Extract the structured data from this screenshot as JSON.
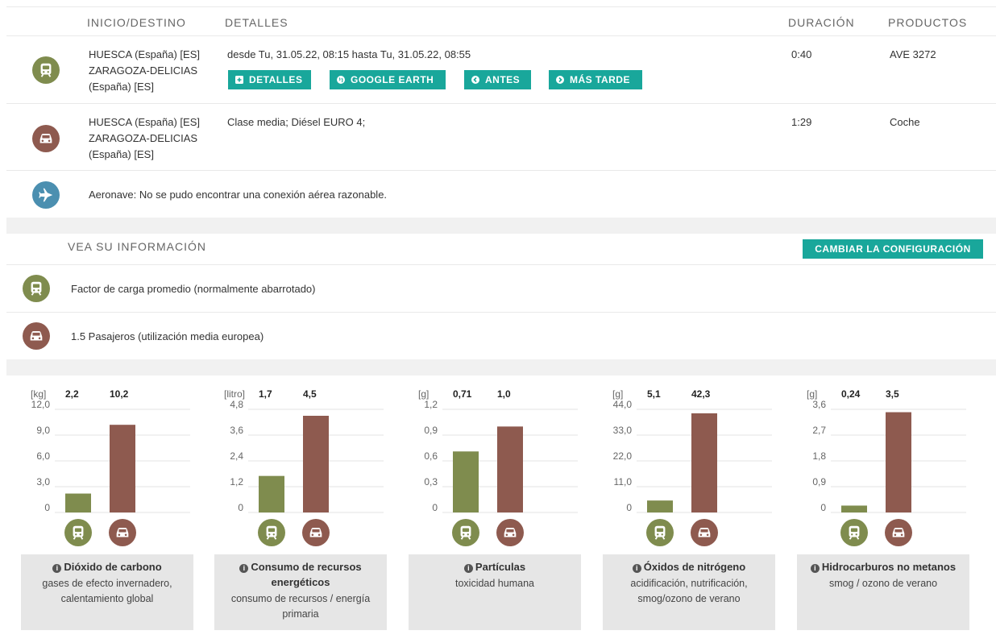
{
  "table": {
    "headers": {
      "origin": "INICIO/DESTINO",
      "details": "DETALLES",
      "duration": "DURACIÓN",
      "products": "PRODUCTOS"
    },
    "rows": [
      {
        "icon": "train-icon",
        "origin_line1": "HUESCA (España) [ES]",
        "origin_line2": "ZARAGOZA-DELICIAS",
        "origin_line3": "(España) [ES]",
        "details": "desde Tu, 31.05.22, 08:15 hasta Tu, 31.05.22, 08:55",
        "duration": "0:40",
        "product": "AVE 3272",
        "buttons": {
          "detalles": "DETALLES",
          "google_earth": "GOOGLE EARTH",
          "antes": "ANTES",
          "mas_tarde": "MÁS TARDE"
        }
      },
      {
        "icon": "car-icon",
        "origin_line1": "HUESCA (España) [ES]",
        "origin_line2": "ZARAGOZA-DELICIAS",
        "origin_line3": "(España) [ES]",
        "details": "Clase media; Diésel EURO 4;",
        "duration": "1:29",
        "product": "Coche"
      },
      {
        "icon": "plane-icon",
        "message": "Aeronave: No se pudo encontrar una conexión aérea razonable."
      }
    ]
  },
  "info": {
    "title": "VEA SU INFORMACIÓN",
    "button": "CAMBIAR LA CONFIGURACIÓN",
    "train_text": "Factor de carga promedio (normalmente abarrotado)",
    "car_text": "1.5 Pasajeros (utilización media europea)"
  },
  "colors": {
    "train": "#7f8c4e",
    "car": "#8e5a4f",
    "plane": "#4b8fb0",
    "accent": "#19a79b"
  },
  "chart_data": [
    {
      "type": "bar",
      "unit": "[kg]",
      "categories": [
        "train",
        "car"
      ],
      "values": [
        2.2,
        10.2
      ],
      "value_labels": [
        "2,2",
        "10,2"
      ],
      "ylim": [
        0,
        12.0
      ],
      "ticks": [
        "0",
        "3,0",
        "6,0",
        "9,0",
        "12,0"
      ],
      "title": "Dióxido de carbono",
      "subtitle": "gases de efecto invernadero, calentamiento global"
    },
    {
      "type": "bar",
      "unit": "[litro]",
      "categories": [
        "train",
        "car"
      ],
      "values": [
        1.7,
        4.5
      ],
      "value_labels": [
        "1,7",
        "4,5"
      ],
      "ylim": [
        0,
        4.8
      ],
      "ticks": [
        "0",
        "1,2",
        "2,4",
        "3,6",
        "4,8"
      ],
      "title": "Consumo de recursos energéticos",
      "subtitle": "consumo de recursos / energía primaria"
    },
    {
      "type": "bar",
      "unit": "[g]",
      "categories": [
        "train",
        "car"
      ],
      "values": [
        0.71,
        1.0
      ],
      "value_labels": [
        "0,71",
        "1,0"
      ],
      "ylim": [
        0,
        1.2
      ],
      "ticks": [
        "0",
        "0,3",
        "0,6",
        "0,9",
        "1,2"
      ],
      "title": "Partículas",
      "subtitle": "toxicidad humana"
    },
    {
      "type": "bar",
      "unit": "[g]",
      "categories": [
        "train",
        "car"
      ],
      "values": [
        5.1,
        42.3
      ],
      "value_labels": [
        "5,1",
        "42,3"
      ],
      "ylim": [
        0,
        44.0
      ],
      "ticks": [
        "0",
        "11,0",
        "22,0",
        "33,0",
        "44,0"
      ],
      "title": "Óxidos de nitrógeno",
      "subtitle": "acidificación, nutrificación, smog/ozono de verano"
    },
    {
      "type": "bar",
      "unit": "[g]",
      "categories": [
        "train",
        "car"
      ],
      "values": [
        0.24,
        3.5
      ],
      "value_labels": [
        "0,24",
        "3,5"
      ],
      "ylim": [
        0,
        3.6
      ],
      "ticks": [
        "0",
        "0,9",
        "1,8",
        "2,7",
        "3,6"
      ],
      "title": "Hidrocarburos no metanos",
      "subtitle": "smog / ozono de verano"
    }
  ]
}
